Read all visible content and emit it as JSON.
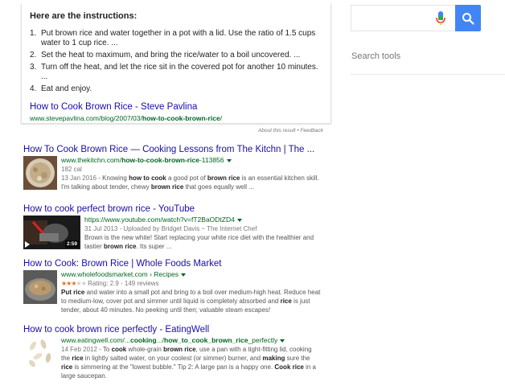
{
  "snippet": {
    "heading": "Here are the instructions:",
    "steps": [
      "Put brown rice and water together in a pot with a lid. Use the ratio of 1.5 cups water to 1 cup rice. ...",
      "Set the heat to maximum, and bring the rice/water to a boil uncovered. ...",
      "Turn off the heat, and let the rice sit in the covered pot for another 10 minutes. ...",
      "Eat and enjoy."
    ],
    "link_title": "How to Cook Brown Rice - Steve Pavlina",
    "url_plain": "www.stevepavlina.com/blog/2007/03/",
    "url_bold": "how-to-cook-brown-rice",
    "url_end": "/",
    "about": "About this result",
    "sep": " • ",
    "feedback": "Feedback"
  },
  "right": {
    "search_tools": "Search tools"
  },
  "results": [
    {
      "title": "How To Cook Brown Rice — Cooking Lessons from The Kitchn | The ...",
      "url_plain": "www.thekitchn.com/",
      "url_bold": "how-to-cook-brown-rice",
      "url_end": "-113856",
      "meta": "182 cal",
      "date": "13 Jan 2016",
      "snippet_parts": [
        " - Knowing ",
        "how to cook",
        " a good pot of ",
        "brown rice",
        " is an essential kitchen skill. I'm talking about tender, chewy ",
        "brown rice",
        " that goes equally well ..."
      ]
    },
    {
      "title": "How to cook perfect brown rice - YouTube",
      "url": "https://www.youtube.com/watch?v=fT2BaODtZD4",
      "meta": "31 Jul 2013 - Uploaded by Bridget Davis ~ The Internet Chef",
      "snippet_parts": [
        "Brown is the new white! Start replacing your white rice diet with the healthier and tastier ",
        "brown rice",
        ". Its super ..."
      ],
      "duration": "2:59"
    },
    {
      "title": "How to Cook: Brown Rice | Whole Foods Market",
      "url": "www.wholefoodsmarket.com › Recipes",
      "stars_on": "★★★",
      "stars_off": "★★",
      "rating": "Rating: 2.9 - 149 reviews",
      "snippet_parts": [
        "Put rice",
        " and water into a small pot and bring to a boil over medium-high heat. Reduce heat to medium-low, cover pot and simmer until liquid is completely absorbed and ",
        "rice",
        " is just tender, about 40 minutes. No peeking until then; valuable steam escapes!"
      ]
    },
    {
      "title": "How to cook brown rice perfectly - EatingWell",
      "url_plain": "www.eatingwell.com/...",
      "url_bold1": "cooking",
      "url_mid": ".../",
      "url_bold2": "how_to_cook_brown_rice",
      "url_end": "_perfectly",
      "date": "14 Feb 2012",
      "snippet_parts": [
        " - To ",
        "cook",
        " whole-grain ",
        "brown rice",
        ", use a pan with a tight-fitting lid, cooking the ",
        "rice",
        " in lightly salted water, on your coolest (or simmer) burner, and ",
        "making",
        " sure the ",
        "rice",
        " is simmering at the \"lowest bubble.\" Tip 2: A large pan is a happy one. ",
        "Cook rice",
        " in a large saucepan."
      ]
    }
  ],
  "colors": {
    "link": "#1a0dab",
    "url": "#006621",
    "search_button": "#4285f4",
    "stars": "#e7711b"
  },
  "icons": [
    "microphone-icon",
    "magnifier-icon",
    "play-icon"
  ]
}
